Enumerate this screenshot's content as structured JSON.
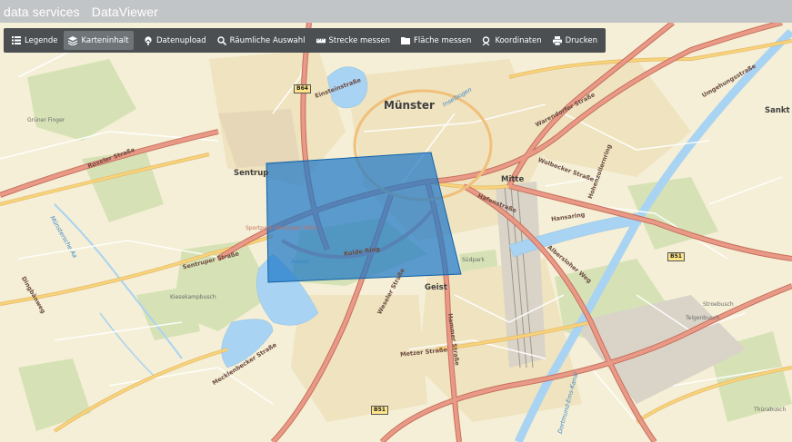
{
  "header": {
    "brand": "data services",
    "app_title": "DataViewer"
  },
  "toolbar_left": [
    {
      "label": "Legende",
      "icon": "list-icon"
    },
    {
      "label": "Karteninhalt",
      "icon": "layers-icon",
      "active": true
    }
  ],
  "toolbar_right": [
    {
      "label": "Datenupload",
      "icon": "upload-icon"
    },
    {
      "label": "Räumliche Auswahl",
      "icon": "spatial-select-icon"
    },
    {
      "label": "Strecke messen",
      "icon": "ruler-icon"
    },
    {
      "label": "Fläche messen",
      "icon": "area-icon"
    },
    {
      "label": "Koordinaten",
      "icon": "coordinates-icon"
    },
    {
      "label": "Drucken",
      "icon": "print-icon"
    }
  ],
  "colors": {
    "header_bg": "#c2c5c7",
    "toolbar_bg": "#4b4f52",
    "map_bg": "#f4efd6",
    "road_major": "#e08a78",
    "road_secondary": "#f6d47a",
    "water": "#a9d3f2",
    "selection_fill": "#1f78c8"
  },
  "map": {
    "places": {
      "muenster": "Münster",
      "sentrup": "Sentrup",
      "mitte": "Mitte",
      "geist": "Geist",
      "sankt_m": "Sankt M"
    },
    "areas": {
      "gruener_finger": "Grüner Finger",
      "klosekampbusch": "Kiesekampbusch",
      "suedpark": "Südpark",
      "telgenbusch": "Telgenbusch",
      "stroebusch": "Stroebusch",
      "thuerabusch": "Thürabusch",
      "sportpark": "Sportpark Sentruper Höhe",
      "aasee": "Aasee"
    },
    "streets": {
      "roxeler": "Roxeler Straße",
      "sentruper": "Sentruper Straße",
      "weseler": "Weseler Straße",
      "hammer": "Hammer Straße",
      "warendorfer": "Warendorfer Straße",
      "wolbecker": "Wolbecker Straße",
      "albersloher": "Albersloher Weg",
      "hafen": "Hafenstraße",
      "kolde": "Kolde-Ring",
      "hansa": "Hansaring",
      "metzer": "Metzer Straße",
      "mecklenbecker": "Mecklenbecker Straße",
      "dingbaenweg": "Dingbänweg",
      "hohenzollern": "Hohenzollernring",
      "umgehung": "Umgehungsstraße",
      "einstein": "Einsteinstraße",
      "dortmund_ems": "Dortmund-Ems-Kanal",
      "muensterische_aa": "Münstersche Aa",
      "inselbogen": "Inselbogen"
    },
    "badges": {
      "b64": "B64",
      "b51a": "B51",
      "b51b": "B51"
    }
  }
}
